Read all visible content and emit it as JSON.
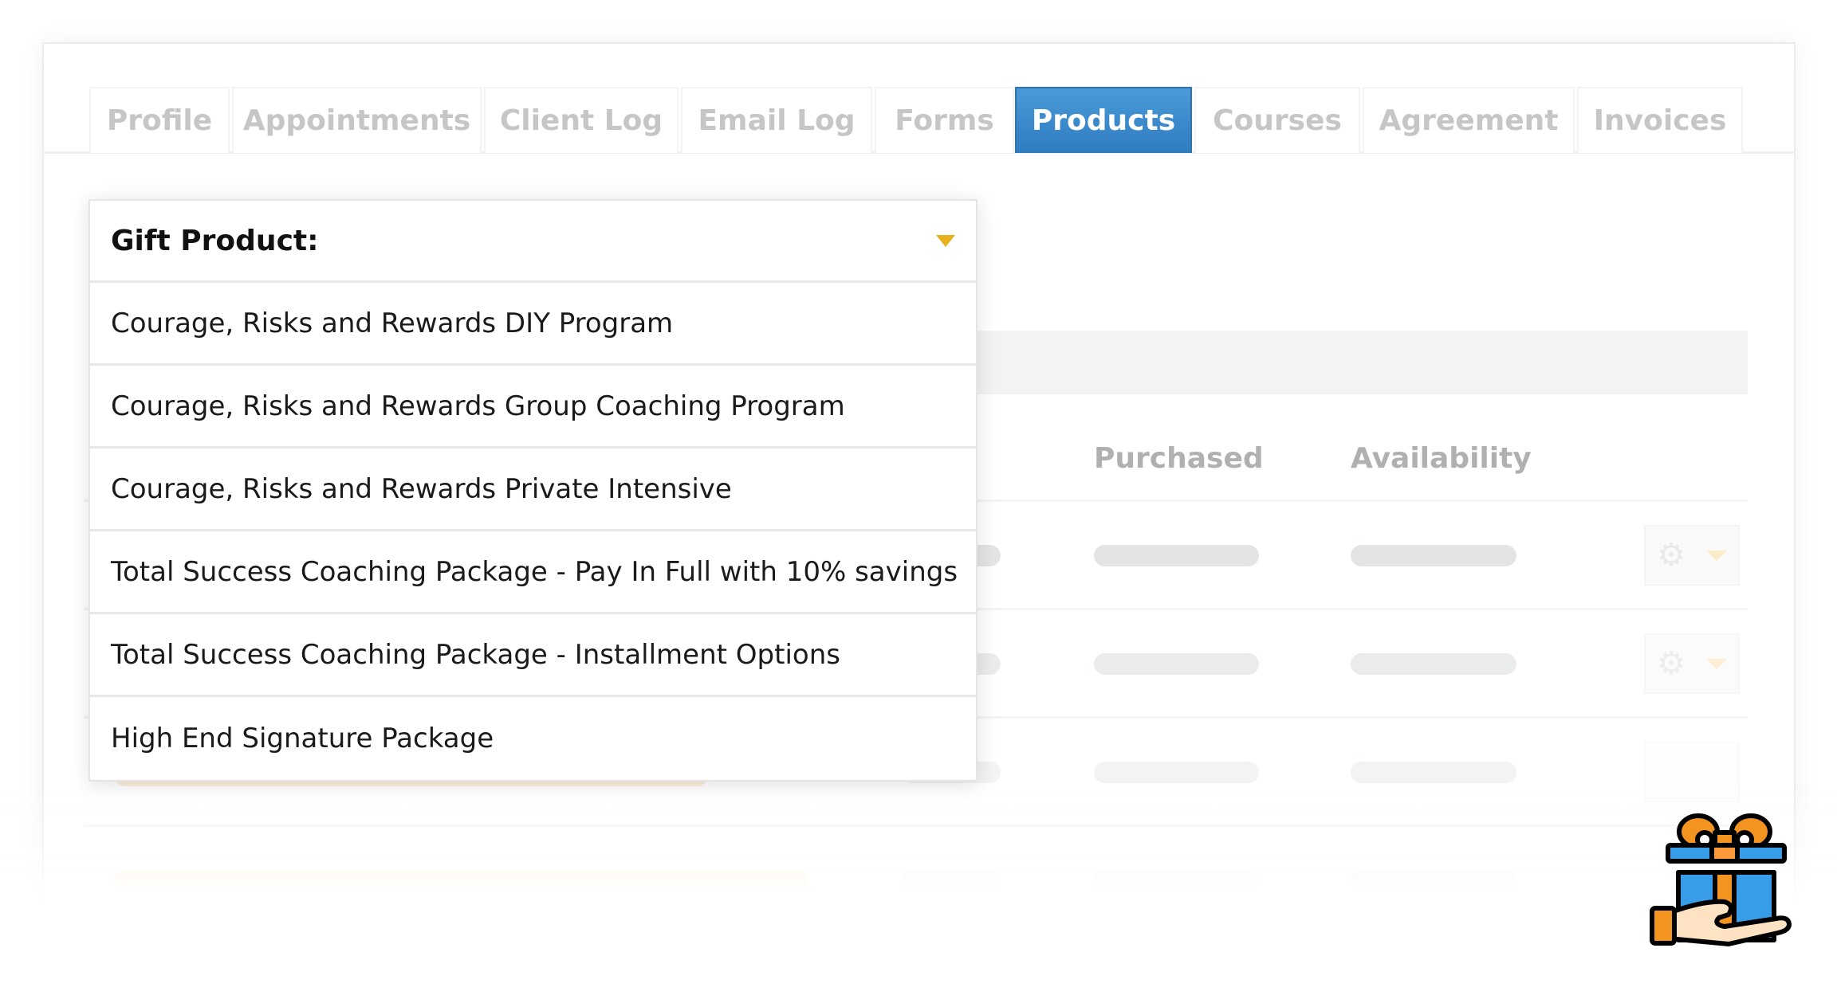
{
  "tabs": [
    {
      "label": "Profile",
      "active": false
    },
    {
      "label": "Appointments",
      "active": false
    },
    {
      "label": "Client Log",
      "active": false
    },
    {
      "label": "Email Log",
      "active": false
    },
    {
      "label": "Forms",
      "active": false
    },
    {
      "label": "Products",
      "active": true
    },
    {
      "label": "Courses",
      "active": false
    },
    {
      "label": "Agreement",
      "active": false
    },
    {
      "label": "Invoices",
      "active": false
    }
  ],
  "table": {
    "columns": {
      "purchased": "Purchased",
      "availability": "Availability"
    }
  },
  "dropdown": {
    "label": "Gift Product:",
    "options": [
      "Courage, Risks and Rewards DIY Program",
      "Courage, Risks and Rewards Group Coaching Program",
      "Courage, Risks and Rewards Private Intensive",
      "Total Success Coaching Package - Pay In Full with 10% savings",
      "Total Success Coaching Package - Installment Options",
      "High End Signature Package"
    ]
  },
  "colors": {
    "accent": "#2f7cc0",
    "caret": "#e6b01e",
    "gift_blue": "#389de8",
    "gift_orange": "#f39420"
  },
  "icons": {
    "gift": "gift-in-hand-icon",
    "gear": "gear-icon"
  }
}
